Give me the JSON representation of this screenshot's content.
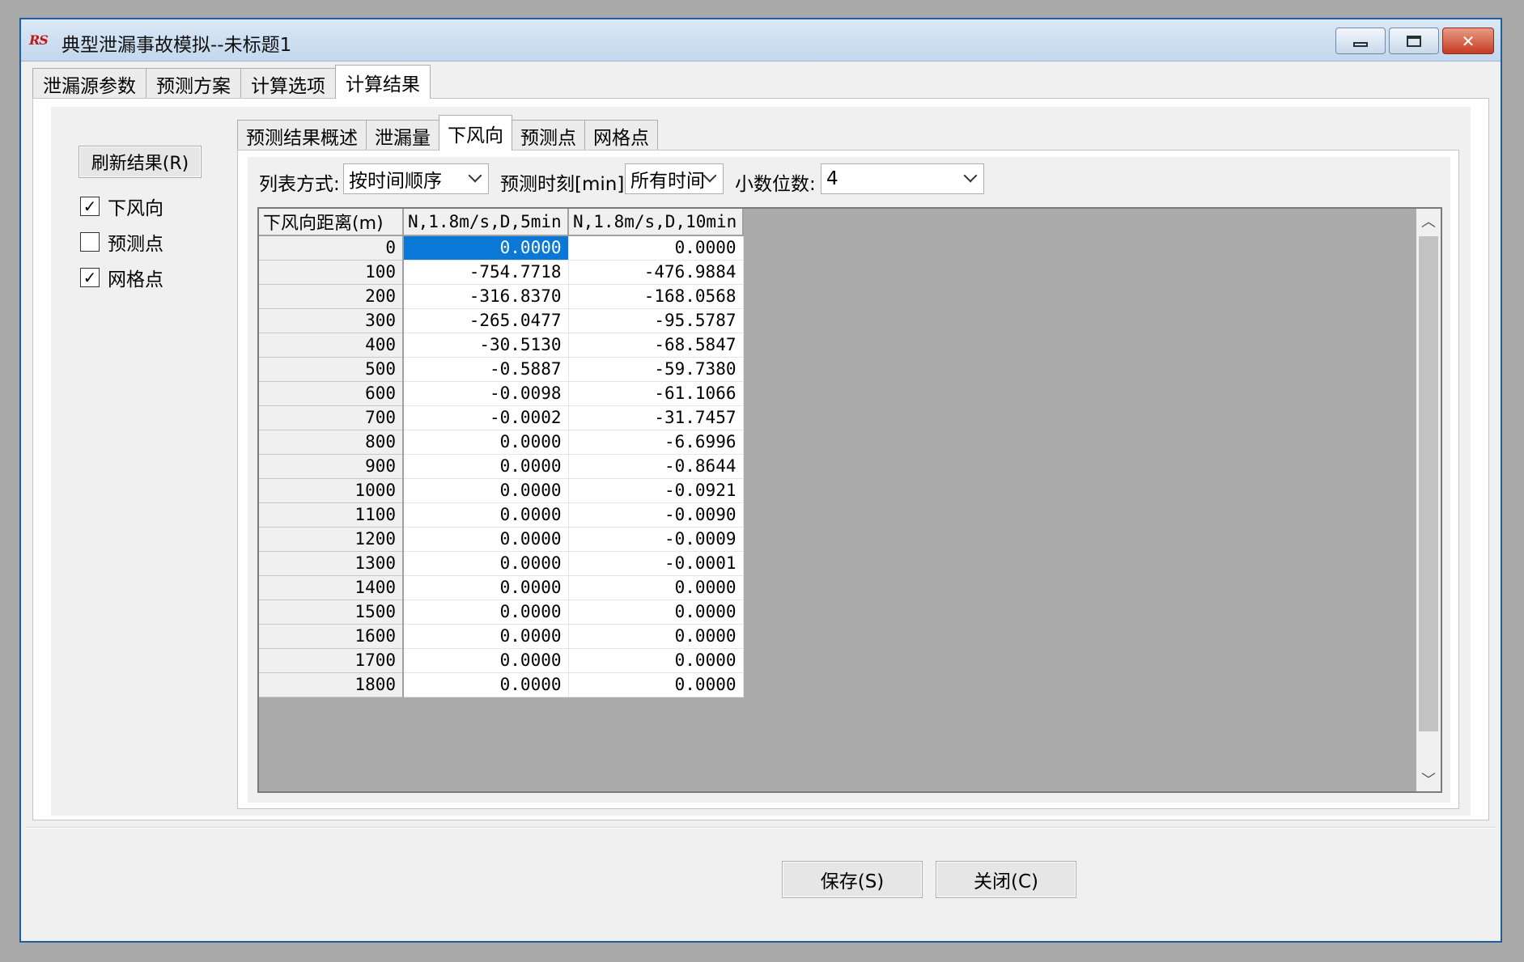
{
  "window": {
    "title": "典型泄漏事故模拟--未标题1",
    "app_icon": "RS",
    "close_glyph": "✕"
  },
  "main_tabs": [
    {
      "label": "泄漏源参数"
    },
    {
      "label": "预测方案"
    },
    {
      "label": "计算选项"
    },
    {
      "label": "计算结果"
    }
  ],
  "left": {
    "refresh_label": "刷新结果(R)",
    "checks": [
      {
        "label": "下风向",
        "checked": true,
        "mark": "✓"
      },
      {
        "label": "预测点",
        "checked": false,
        "mark": ""
      },
      {
        "label": "网格点",
        "checked": true,
        "mark": "✓"
      }
    ]
  },
  "sub_tabs": [
    {
      "label": "预测结果概述"
    },
    {
      "label": "泄漏量"
    },
    {
      "label": "下风向"
    },
    {
      "label": "预测点"
    },
    {
      "label": "网格点"
    }
  ],
  "options": {
    "list_mode_label": "列表方式:",
    "list_mode_value": "按时间顺序",
    "time_label": "预测时刻[min]:",
    "time_value": "所有时间",
    "decimals_label": "小数位数:",
    "decimals_value": "4"
  },
  "grid": {
    "headers": [
      "下风向距离(m)",
      "N,1.8m/s,D,5min",
      "N,1.8m/s,D,10min"
    ],
    "rows": [
      [
        "0",
        "0.0000",
        "0.0000"
      ],
      [
        "100",
        "-754.7718",
        "-476.9884"
      ],
      [
        "200",
        "-316.8370",
        "-168.0568"
      ],
      [
        "300",
        "-265.0477",
        "-95.5787"
      ],
      [
        "400",
        "-30.5130",
        "-68.5847"
      ],
      [
        "500",
        "-0.5887",
        "-59.7380"
      ],
      [
        "600",
        "-0.0098",
        "-61.1066"
      ],
      [
        "700",
        "-0.0002",
        "-31.7457"
      ],
      [
        "800",
        "0.0000",
        "-6.6996"
      ],
      [
        "900",
        "0.0000",
        "-0.8644"
      ],
      [
        "1000",
        "0.0000",
        "-0.0921"
      ],
      [
        "1100",
        "0.0000",
        "-0.0090"
      ],
      [
        "1200",
        "0.0000",
        "-0.0009"
      ],
      [
        "1300",
        "0.0000",
        "-0.0001"
      ],
      [
        "1400",
        "0.0000",
        "0.0000"
      ],
      [
        "1500",
        "0.0000",
        "0.0000"
      ],
      [
        "1600",
        "0.0000",
        "0.0000"
      ],
      [
        "1700",
        "0.0000",
        "0.0000"
      ],
      [
        "1800",
        "0.0000",
        "0.0000"
      ]
    ]
  },
  "footer": {
    "save_label": "保存(S)",
    "close_label": "关闭(C)"
  },
  "colors": {
    "selection": "#0a78d7",
    "title_bar": "#c3d7ee",
    "close_button": "#c63b21"
  }
}
